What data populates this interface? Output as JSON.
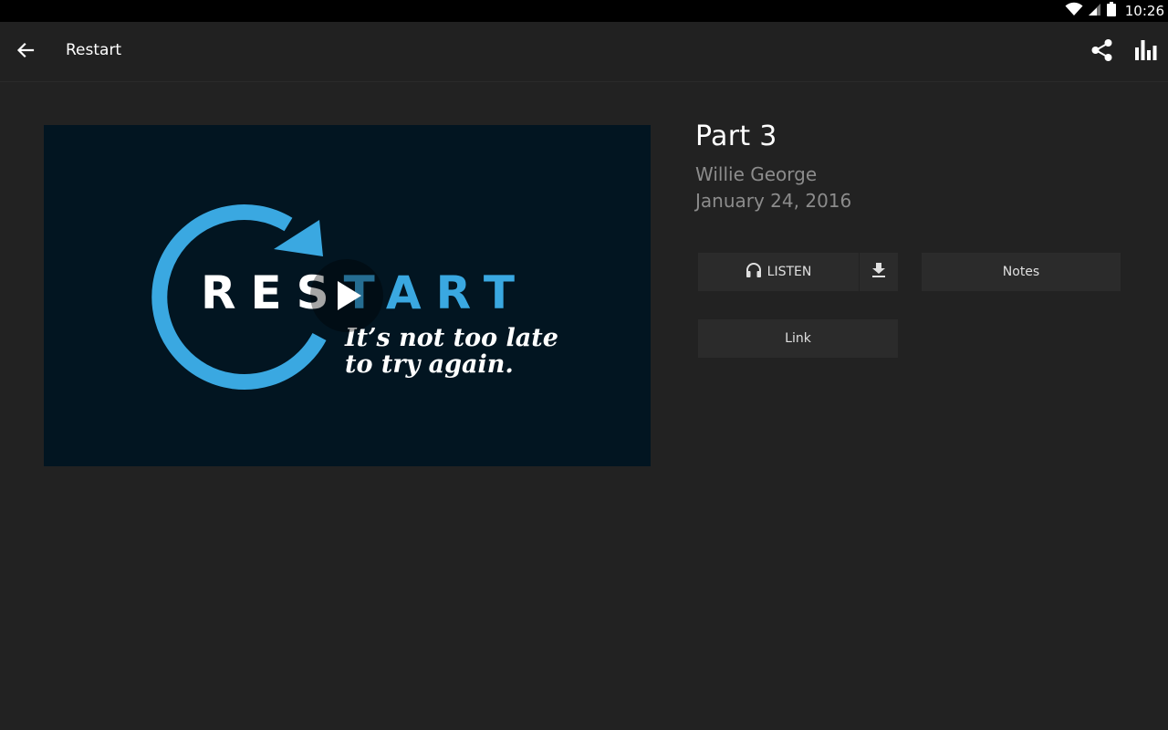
{
  "status_bar": {
    "time": "10:26",
    "icons": [
      "wifi-icon",
      "signal-icon",
      "battery-icon"
    ]
  },
  "app_bar": {
    "back_icon": "arrow-back-icon",
    "title": "Restart",
    "actions": [
      "share-icon",
      "bar-chart-icon"
    ]
  },
  "video": {
    "brand_white": "RES",
    "brand_blue": "TART",
    "tagline_line1": "It’s not too late",
    "tagline_line2": "to try again.",
    "play_icon": "play-icon",
    "colors": {
      "background": "#021521",
      "accent": "#3aa8e1"
    }
  },
  "episode": {
    "title": "Part 3",
    "speaker": "Willie George",
    "date": "January 24, 2016"
  },
  "actions": {
    "listen_label": "LISTEN",
    "listen_icon": "headphones-icon",
    "download_icon": "download-icon",
    "notes_label": "Notes",
    "link_label": "Link"
  }
}
